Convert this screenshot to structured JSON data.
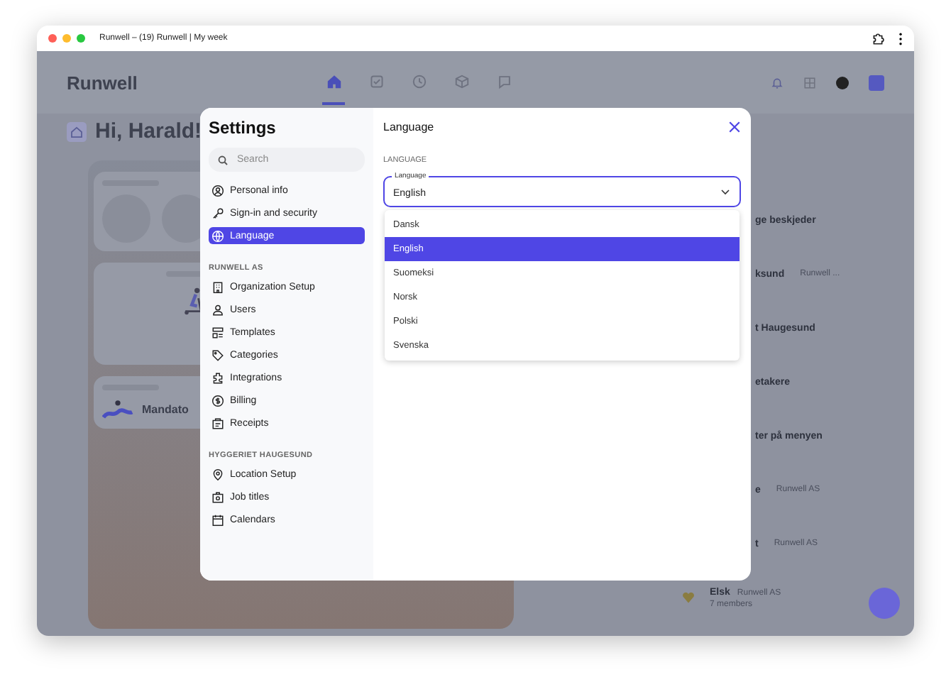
{
  "browser": {
    "title": "Runwell – (19) Runwell | My week"
  },
  "app": {
    "logo": "Runwell",
    "greeting": "Hi, Harald!",
    "nav": [
      {
        "selected": true
      },
      {
        "selected": false
      },
      {
        "selected": false
      },
      {
        "selected": false
      },
      {
        "selected": false
      }
    ],
    "message": {
      "heading": "Mandato"
    },
    "list": [
      {
        "kind": "row",
        "title": "ge beskjeder"
      },
      {
        "kind": "row",
        "title": "ksund",
        "meta": "Runwell ..."
      },
      {
        "kind": "row",
        "title": "t Haugesund"
      },
      {
        "kind": "row",
        "title": "etakere"
      },
      {
        "kind": "row",
        "title": "ter på menyen"
      },
      {
        "kind": "row",
        "title": "e",
        "meta": "Runwell AS"
      },
      {
        "kind": "row",
        "title": "t",
        "meta": "Runwell AS"
      },
      {
        "kind": "group",
        "title": "Elsk",
        "meta": "Runwell AS",
        "sub": "7 members"
      }
    ]
  },
  "settings": {
    "title": "Settings",
    "search": {
      "placeholder": "Search"
    },
    "groups": [
      {
        "items": [
          {
            "label": "Personal info",
            "selected": false
          },
          {
            "label": "Sign-in and security",
            "selected": false
          },
          {
            "label": "Language",
            "selected": true
          }
        ]
      },
      {
        "heading": "RUNWELL AS",
        "items": [
          {
            "label": "Organization Setup",
            "selected": false
          },
          {
            "label": "Users",
            "selected": false
          },
          {
            "label": "Templates",
            "selected": false
          },
          {
            "label": "Categories",
            "selected": false
          },
          {
            "label": "Integrations",
            "selected": false
          },
          {
            "label": "Billing",
            "selected": false
          },
          {
            "label": "Receipts",
            "selected": false
          }
        ]
      },
      {
        "heading": "HYGGERIET HAUGESUND",
        "items": [
          {
            "label": "Location Setup",
            "selected": false
          },
          {
            "label": "Job titles",
            "selected": false
          },
          {
            "label": "Calendars",
            "selected": false
          }
        ]
      }
    ],
    "panel": {
      "title": "Language",
      "section": "LANGUAGE",
      "select": {
        "label": "Language",
        "value": "English",
        "expanded": true
      },
      "options": [
        {
          "label": "Dansk",
          "selected": false
        },
        {
          "label": "English",
          "selected": true
        },
        {
          "label": "Suomeksi",
          "selected": false
        },
        {
          "label": "Norsk",
          "selected": false
        },
        {
          "label": "Polski",
          "selected": false
        },
        {
          "label": "Svenska",
          "selected": false
        }
      ]
    }
  }
}
